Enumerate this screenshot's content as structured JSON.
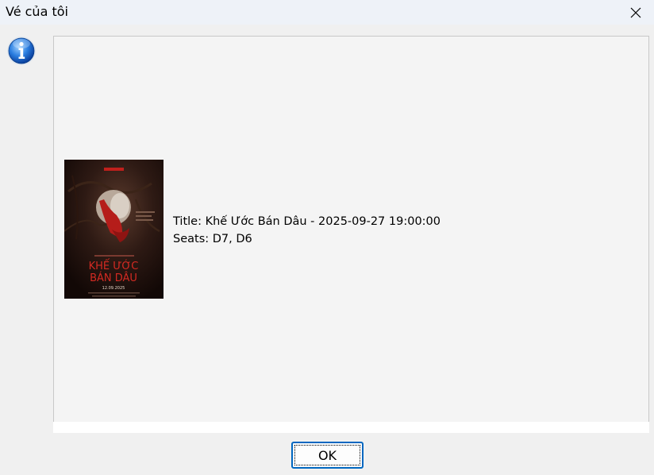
{
  "window": {
    "title": "Vé của tôi",
    "close_icon": "close-icon"
  },
  "dialog": {
    "icon": "info-icon",
    "ticket": {
      "title_line": "Title: Khế Ước Bán Dâu - 2025-09-27 19:00:00",
      "seats_line": "Seats: D7, D6",
      "poster": {
        "heading": "KHẾ ƯỚC BÁN DÂU",
        "date": "12.09.2025"
      }
    },
    "ok_label": "OK"
  },
  "colors": {
    "titlebar": "#eef2f8",
    "panel": "#f4f4f4",
    "button_border": "#0067c0",
    "poster_bg": "#2a1512",
    "poster_red": "#c0201c"
  }
}
